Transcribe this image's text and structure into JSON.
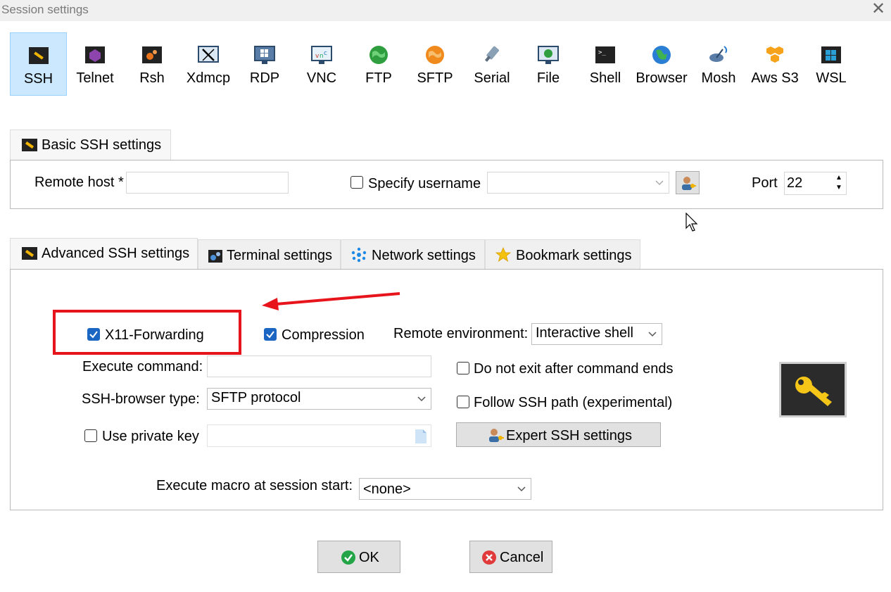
{
  "window": {
    "title": "Session settings"
  },
  "session_types": [
    {
      "label": "SSH",
      "icon": "ssh-icon",
      "selected": true
    },
    {
      "label": "Telnet",
      "icon": "telnet-icon"
    },
    {
      "label": "Rsh",
      "icon": "rsh-icon"
    },
    {
      "label": "Xdmcp",
      "icon": "xdmcp-icon"
    },
    {
      "label": "RDP",
      "icon": "rdp-icon"
    },
    {
      "label": "VNC",
      "icon": "vnc-icon"
    },
    {
      "label": "FTP",
      "icon": "ftp-icon"
    },
    {
      "label": "SFTP",
      "icon": "sftp-icon"
    },
    {
      "label": "Serial",
      "icon": "serial-icon"
    },
    {
      "label": "File",
      "icon": "file-icon"
    },
    {
      "label": "Shell",
      "icon": "shell-icon"
    },
    {
      "label": "Browser",
      "icon": "browser-icon"
    },
    {
      "label": "Mosh",
      "icon": "mosh-icon"
    },
    {
      "label": "Aws S3",
      "icon": "aws-s3-icon"
    },
    {
      "label": "WSL",
      "icon": "wsl-icon"
    }
  ],
  "basic": {
    "tab_label": "Basic SSH settings",
    "remote_host_label": "Remote host *",
    "remote_host_value": "",
    "specify_username_label": "Specify username",
    "specify_username_checked": false,
    "username_value": "",
    "port_label": "Port",
    "port_value": "22"
  },
  "tabs": [
    {
      "label": "Advanced SSH settings",
      "icon": "wrench-icon",
      "active": true
    },
    {
      "label": "Terminal settings",
      "icon": "gears-icon"
    },
    {
      "label": "Network settings",
      "icon": "network-icon"
    },
    {
      "label": "Bookmark settings",
      "icon": "star-icon"
    }
  ],
  "advanced": {
    "x11_label": "X11-Forwarding",
    "x11_checked": true,
    "compression_label": "Compression",
    "compression_checked": true,
    "remote_env_label": "Remote environment:",
    "remote_env_value": "Interactive shell",
    "execute_command_label": "Execute command:",
    "execute_command_value": "",
    "do_not_exit_label": "Do not exit after command ends",
    "do_not_exit_checked": false,
    "browser_type_label": "SSH-browser type:",
    "browser_type_value": "SFTP protocol",
    "follow_path_label": "Follow SSH path (experimental)",
    "follow_path_checked": false,
    "private_key_label": "Use private key",
    "private_key_checked": false,
    "private_key_value": "",
    "expert_button_label": "Expert SSH settings",
    "macro_label": "Execute macro at session start:",
    "macro_value": "<none>"
  },
  "buttons": {
    "ok": "OK",
    "cancel": "Cancel"
  },
  "colors": {
    "accent": "#1a66c2",
    "selected_bg": "#cce8ff",
    "annotation_red": "#e8141b",
    "ok_green": "#22a447",
    "cancel_red": "#e03a3a"
  }
}
